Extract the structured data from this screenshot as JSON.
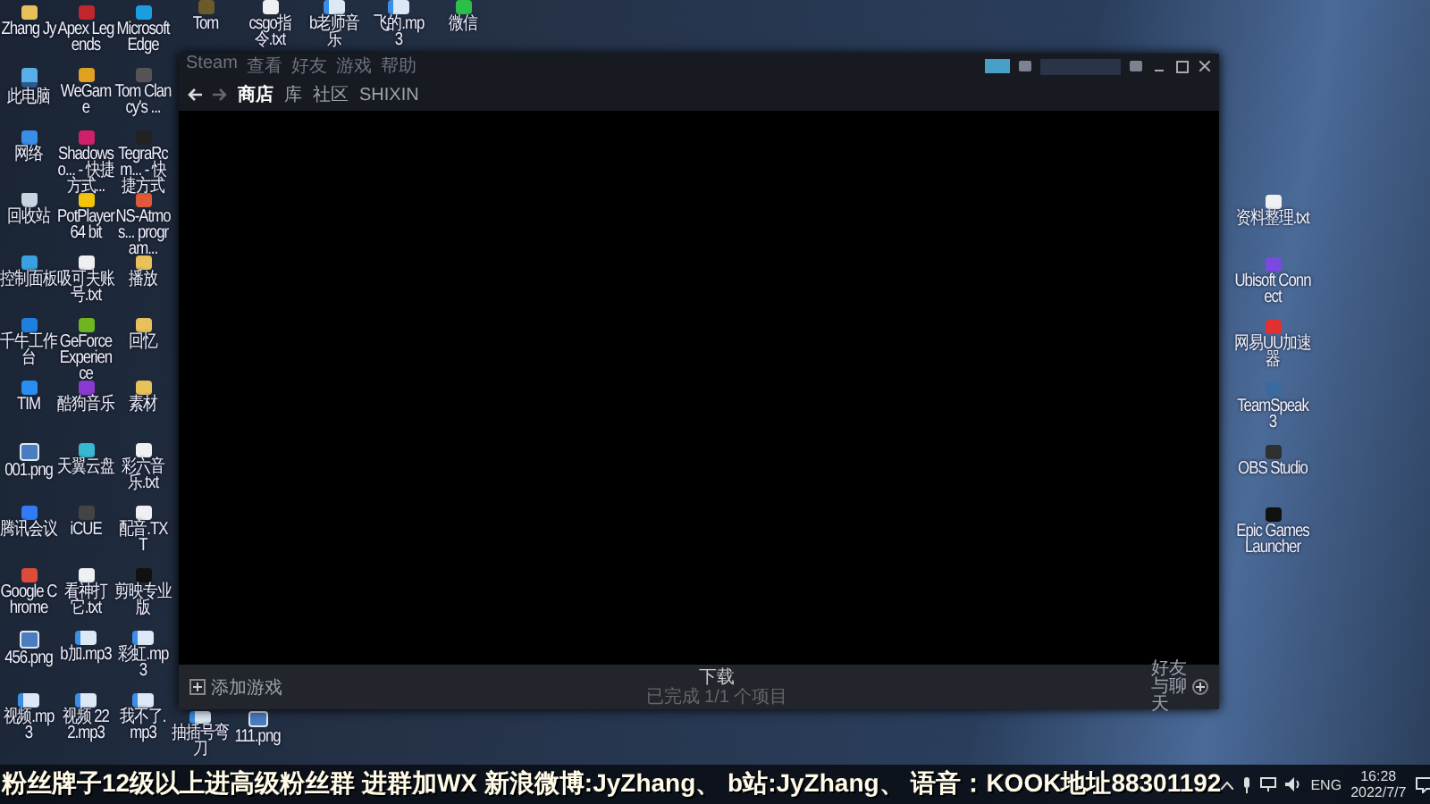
{
  "desktop": {
    "left_columns": [
      [
        {
          "label": "Zhang Jy",
          "kind": "folder"
        },
        {
          "label": "此电脑",
          "kind": "pc"
        },
        {
          "label": "网络",
          "kind": "app",
          "color": "#3a8ee6"
        },
        {
          "label": "回收站",
          "kind": "bin"
        },
        {
          "label": "控制面板",
          "kind": "app",
          "color": "#3aa0e0"
        },
        {
          "label": "千牛工作台",
          "kind": "app",
          "color": "#1d7fe0"
        },
        {
          "label": "TIM",
          "kind": "app",
          "color": "#2a8ef0"
        },
        {
          "label": "001.png",
          "kind": "image"
        },
        {
          "label": "腾讯会议",
          "kind": "app",
          "color": "#2f7cf6"
        },
        {
          "label": "Google Chrome",
          "kind": "app",
          "color": "#dd4b39"
        },
        {
          "label": "456.png",
          "kind": "image"
        },
        {
          "label": "视频.mp3",
          "kind": "audio"
        }
      ],
      [
        {
          "label": "Apex Legends",
          "kind": "app",
          "color": "#c0272d"
        },
        {
          "label": "WeGame",
          "kind": "app",
          "color": "#e0a020"
        },
        {
          "label": "Shadowso... - 快捷方式...",
          "kind": "app",
          "color": "#d0206a"
        },
        {
          "label": "PotPlayer 64 bit",
          "kind": "app",
          "color": "#f2c40c"
        },
        {
          "label": "吸可夫账号.txt",
          "kind": "file"
        },
        {
          "label": "GeForce Experience",
          "kind": "app",
          "color": "#6fb520"
        },
        {
          "label": "酷狗音乐",
          "kind": "app",
          "color": "#8a3ad0"
        },
        {
          "label": "天翼云盘",
          "kind": "app",
          "color": "#38b7d0"
        },
        {
          "label": "iCUE",
          "kind": "app",
          "color": "#444444"
        },
        {
          "label": "看神打它.txt",
          "kind": "file"
        },
        {
          "label": "b加.mp3",
          "kind": "audio"
        },
        {
          "label": "视频 222.mp3",
          "kind": "audio"
        }
      ],
      [
        {
          "label": "Microsoft Edge",
          "kind": "app",
          "color": "#1b9de2"
        },
        {
          "label": "Tom Clancy's ...",
          "kind": "app",
          "color": "#555555"
        },
        {
          "label": "TegraRcm... - 快捷方式",
          "kind": "app",
          "color": "#222222"
        },
        {
          "label": "NS-Atmos... program...",
          "kind": "app",
          "color": "#e05a3a"
        },
        {
          "label": "播放",
          "kind": "folder"
        },
        {
          "label": "回忆",
          "kind": "folder"
        },
        {
          "label": "素材",
          "kind": "folder"
        },
        {
          "label": "彩六音乐.txt",
          "kind": "file"
        },
        {
          "label": "配音.TXT",
          "kind": "file"
        },
        {
          "label": "剪映专业版",
          "kind": "app",
          "color": "#111111"
        },
        {
          "label": "彩虹.mp3",
          "kind": "audio"
        },
        {
          "label": "我不了.mp3",
          "kind": "audio"
        }
      ]
    ],
    "top_row": [
      {
        "label": "Tom",
        "kind": "app",
        "color": "#6b5a2a"
      },
      {
        "label": "csgo指令.txt",
        "kind": "file"
      },
      {
        "label": "b老师音乐",
        "kind": "audio"
      },
      {
        "label": "飞的.mp3",
        "kind": "audio"
      },
      {
        "label": "微信",
        "kind": "app",
        "color": "#2bbf4a"
      }
    ],
    "bottom_row": [
      {
        "label": "抽插号弯刀",
        "kind": "audio"
      },
      {
        "label": "111.png",
        "kind": "image"
      }
    ],
    "right_column": [
      {
        "label": "资料整理.txt",
        "kind": "file"
      },
      {
        "label": "Ubisoft Connect",
        "kind": "app",
        "color": "#7a4ae0"
      },
      {
        "label": "网易UU加速器",
        "kind": "app",
        "color": "#e03030"
      },
      {
        "label": "TeamSpeak 3",
        "kind": "app",
        "color": "#3a6aa0"
      },
      {
        "label": "OBS Studio",
        "kind": "app",
        "color": "#303030"
      },
      {
        "label": "Epic Games Launcher",
        "kind": "app",
        "color": "#111111"
      }
    ]
  },
  "steam": {
    "menu": [
      "Steam",
      "查看",
      "好友",
      "游戏",
      "帮助"
    ],
    "nav_tabs": [
      {
        "label": "商店",
        "selected": true
      },
      {
        "label": "库",
        "selected": false
      },
      {
        "label": "社区",
        "selected": false
      },
      {
        "label": "SHIXIN",
        "selected": false
      }
    ],
    "add_game": "添加游戏",
    "downloads_title": "下载",
    "downloads_status": "已完成 1/1 个项目",
    "friends": "好友与聊天"
  },
  "overlay_text": "粉丝牌子12级以上进高级粉丝群 进群加WX  新浪微博:JyZhang、 b站:JyZhang、  语音：KOOK地址88301192",
  "taskbar": {
    "language": "ENG",
    "time": "16:28",
    "date": "2022/7/7"
  }
}
